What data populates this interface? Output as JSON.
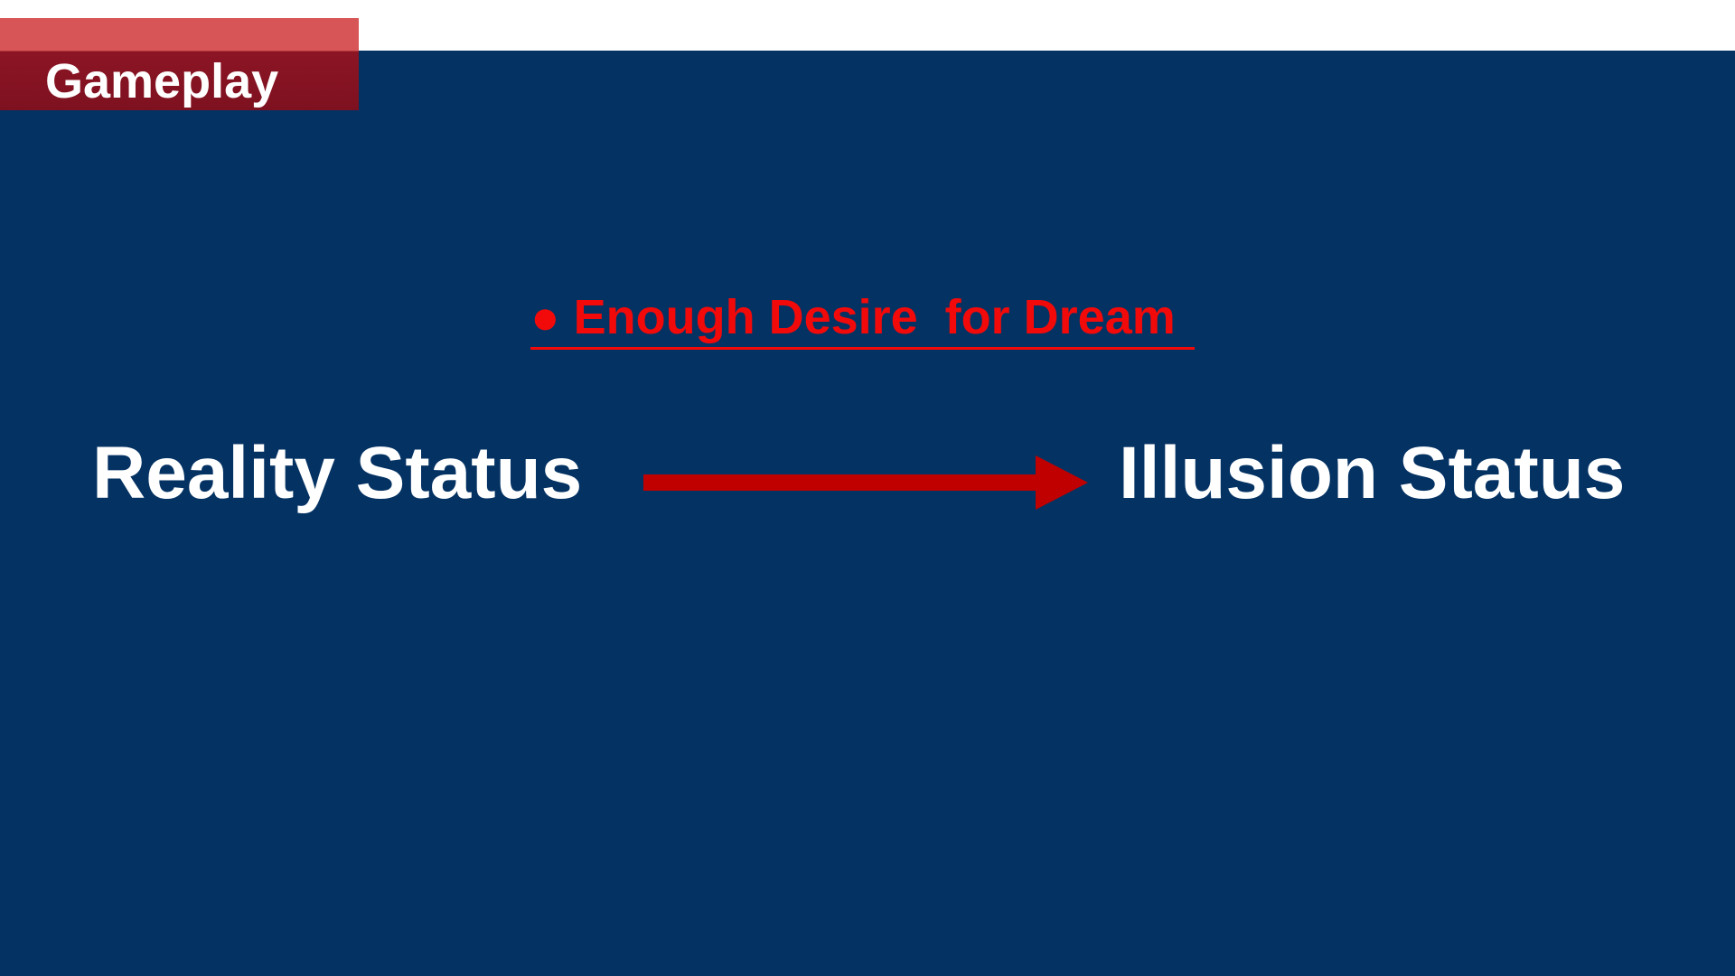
{
  "section_tag": {
    "label": "Gameplay"
  },
  "transition": {
    "condition": "● Enough Desire  for Dream",
    "from_state": "Reality Status",
    "to_state": "Illusion Status"
  },
  "colors": {
    "background": "#043263",
    "top_strip": "#ffffff",
    "tag_top": "#d75557",
    "tag_bottom": "#8c1524",
    "condition_text": "#f20a0a",
    "arrow": "#c00000",
    "state_text": "#ffffff"
  }
}
